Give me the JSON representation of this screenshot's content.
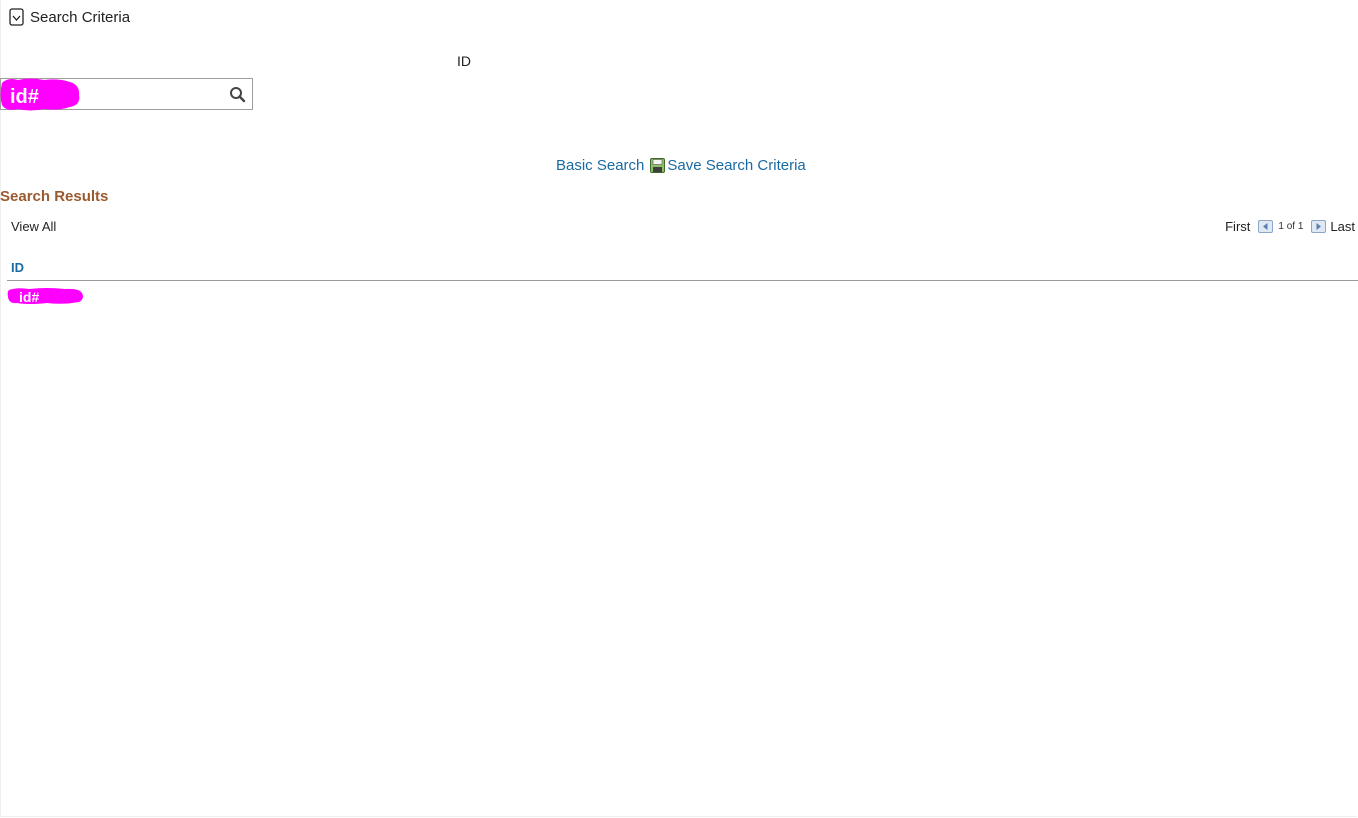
{
  "criteria": {
    "toggle_icon": "collapse-icon",
    "title": "Search Criteria"
  },
  "field": {
    "label": "ID",
    "value": "",
    "placeholder": "",
    "redacted_label": "id#",
    "search_icon": "search-icon"
  },
  "links": {
    "basic_search": "Basic Search",
    "save_icon": "floppy-disk-icon",
    "save_criteria": "Save Search Criteria"
  },
  "results": {
    "title": "Search Results",
    "view_all": "View All",
    "pager": {
      "first": "First",
      "count": "1 of 1",
      "last": "Last",
      "prev_icon": "arrow-left-icon",
      "next_icon": "arrow-right-icon"
    },
    "columns": [
      "ID"
    ],
    "rows": [
      {
        "id_redacted": "id#"
      }
    ]
  },
  "colors": {
    "link": "#1a6aa2",
    "results_title": "#9b5a30",
    "redaction": "#ff00ff"
  }
}
